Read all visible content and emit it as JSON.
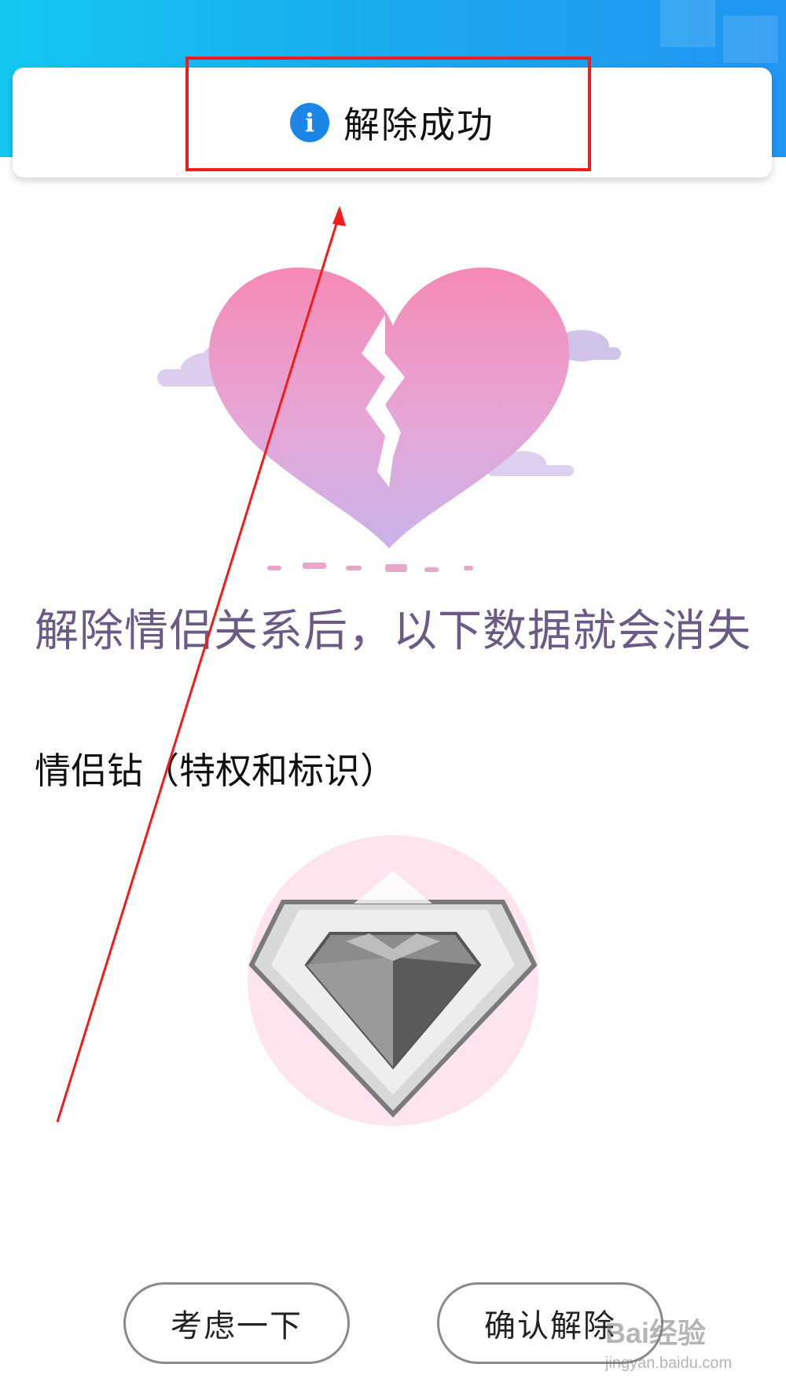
{
  "toast": {
    "icon": "info-icon",
    "message": "解除成功"
  },
  "main": {
    "warning_text": "解除情侣关系后，以下数据就会消失",
    "section_label": "情侣钻（特权和标识）"
  },
  "buttons": {
    "think_label": "考虑一下",
    "confirm_label": "确认解除"
  },
  "watermark": {
    "brand": "Bai经验",
    "url": "jingyan.baidu.com"
  },
  "colors": {
    "header_gradient_start": "#12c8f2",
    "header_gradient_end": "#2196f3",
    "info_icon": "#1b86e8",
    "annotation_red": "#f01c1c",
    "warning_text": "#6b5a86"
  }
}
